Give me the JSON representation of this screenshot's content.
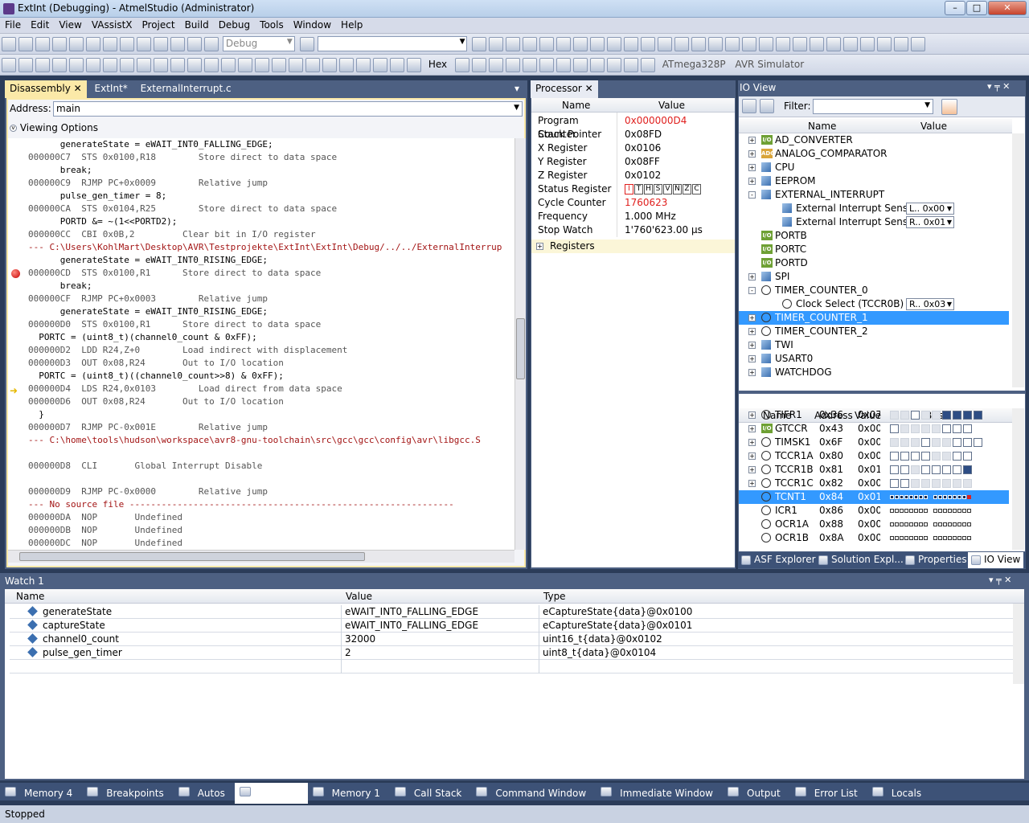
{
  "window": {
    "title": "ExtInt (Debugging) - AtmelStudio (Administrator)",
    "min": "–",
    "max": "□",
    "close": "✕"
  },
  "menu": [
    "File",
    "Edit",
    "View",
    "VAssistX",
    "Project",
    "Build",
    "Debug",
    "Tools",
    "Window",
    "Help"
  ],
  "toolbar": {
    "config": "Debug",
    "hex": "Hex",
    "device": "ATmega328P",
    "tool": "AVR Simulator"
  },
  "disasm": {
    "tabs": [
      "Disassembly",
      "ExtInt*",
      "ExternalInterrupt.c"
    ],
    "address_label": "Address:",
    "address_value": "main",
    "viewing_options": "Viewing Options",
    "lines": [
      {
        "t": "src",
        "text": "      generateState = eWAIT_INT0_FALLING_EDGE;"
      },
      {
        "t": "asm",
        "text": "000000C7  STS 0x0100,R18        Store direct to data space"
      },
      {
        "t": "src",
        "text": "      break;"
      },
      {
        "t": "asm",
        "text": "000000C9  RJMP PC+0x0009        Relative jump"
      },
      {
        "t": "src",
        "text": "      pulse_gen_timer = 8;"
      },
      {
        "t": "asm",
        "text": "000000CA  STS 0x0104,R25        Store direct to data space"
      },
      {
        "t": "src",
        "text": "      PORTD &= ~(1<<PORTD2);"
      },
      {
        "t": "asm",
        "text": "000000CC  CBI 0x0B,2         Clear bit in I/O register"
      },
      {
        "t": "file",
        "text": "--- C:\\Users\\KohlMart\\Desktop\\AVR\\Testprojekte\\ExtInt\\ExtInt\\Debug/../../ExternalInterrup"
      },
      {
        "t": "src",
        "text": "      generateState = eWAIT_INT0_RISING_EDGE;"
      },
      {
        "t": "asm",
        "text": "000000CD  STS 0x0100,R1      Store direct to data space"
      },
      {
        "t": "src",
        "text": "      break;"
      },
      {
        "t": "asm",
        "text": "000000CF  RJMP PC+0x0003        Relative jump"
      },
      {
        "t": "src",
        "text": "      generateState = eWAIT_INT0_RISING_EDGE;"
      },
      {
        "t": "asm",
        "text": "000000D0  STS 0x0100,R1      Store direct to data space"
      },
      {
        "t": "src",
        "text": "  PORTC = (uint8_t)(channel0_count & 0xFF);"
      },
      {
        "t": "asm",
        "text": "000000D2  LDD R24,Z+0        Load indirect with displacement"
      },
      {
        "t": "asm",
        "text": "000000D3  OUT 0x08,R24       Out to I/O location"
      },
      {
        "t": "src",
        "text": "  PORTC = (uint8_t)((channel0_count>>8) & 0xFF);"
      },
      {
        "t": "asm",
        "text": "000000D4  LDS R24,0x0103        Load direct from data space"
      },
      {
        "t": "asm",
        "text": "000000D6  OUT 0x08,R24       Out to I/O location"
      },
      {
        "t": "src",
        "text": "  }"
      },
      {
        "t": "asm",
        "text": "000000D7  RJMP PC-0x001E        Relative jump"
      },
      {
        "t": "file",
        "text": "--- C:\\home\\tools\\hudson\\workspace\\avr8-gnu-toolchain\\src\\gcc\\gcc\\config\\avr\\libgcc.S"
      },
      {
        "t": "asm",
        "text": ""
      },
      {
        "t": "asm",
        "text": "000000D8  CLI       Global Interrupt Disable"
      },
      {
        "t": "asm",
        "text": ""
      },
      {
        "t": "asm",
        "text": "000000D9  RJMP PC-0x0000        Relative jump"
      },
      {
        "t": "file",
        "text": "--- No source file -------------------------------------------------------------"
      },
      {
        "t": "asm",
        "text": "000000DA  NOP       Undefined"
      },
      {
        "t": "asm",
        "text": "000000DB  NOP       Undefined"
      },
      {
        "t": "asm",
        "text": "000000DC  NOP       Undefined"
      }
    ]
  },
  "processor": {
    "tab": "Processor",
    "col_name": "Name",
    "col_value": "Value",
    "rows": [
      {
        "name": "Program Counter",
        "value": "0x000000D4",
        "red": true
      },
      {
        "name": "Stack Pointer",
        "value": "0x08FD"
      },
      {
        "name": "X Register",
        "value": "0x0106"
      },
      {
        "name": "Y Register",
        "value": "0x08FF"
      },
      {
        "name": "Z Register",
        "value": "0x0102"
      },
      {
        "name": "Status Register",
        "value": ""
      },
      {
        "name": "Cycle Counter",
        "value": "1760623",
        "red": true
      },
      {
        "name": "Frequency",
        "value": "1.000 MHz"
      },
      {
        "name": "Stop Watch",
        "value": "1'760'623.00 µs"
      }
    ],
    "sreg_flags": [
      "I",
      "T",
      "H",
      "S",
      "V",
      "N",
      "Z",
      "C"
    ],
    "registers": "Registers"
  },
  "ioview": {
    "title": "IO View",
    "filter_label": "Filter:",
    "col_name": "Name",
    "col_value": "Value",
    "tree": [
      {
        "name": "AD_CONVERTER",
        "icon": "io",
        "exp": "+"
      },
      {
        "name": "ANALOG_COMPARATOR",
        "icon": "ac",
        "exp": "+"
      },
      {
        "name": "CPU",
        "icon": "cube",
        "exp": "+"
      },
      {
        "name": "EEPROM",
        "icon": "cube",
        "exp": "+"
      },
      {
        "name": "EXTERNAL_INTERRUPT",
        "icon": "cube",
        "exp": "-"
      },
      {
        "name": "External Interrupt Sense...",
        "icon": "cube",
        "exp": "",
        "indent": 1,
        "combo": "L.. 0x00"
      },
      {
        "name": "External Interrupt Sense...",
        "icon": "cube",
        "exp": "",
        "indent": 1,
        "combo": "R.. 0x01"
      },
      {
        "name": "PORTB",
        "icon": "io",
        "exp": ""
      },
      {
        "name": "PORTC",
        "icon": "io",
        "exp": ""
      },
      {
        "name": "PORTD",
        "icon": "io",
        "exp": ""
      },
      {
        "name": "SPI",
        "icon": "cube",
        "exp": "+"
      },
      {
        "name": "TIMER_COUNTER_0",
        "icon": "clock",
        "exp": "-"
      },
      {
        "name": "Clock Select (TCCR0B)",
        "icon": "clock",
        "exp": "",
        "indent": 1,
        "combo": "R.. 0x03"
      },
      {
        "name": "TIMER_COUNTER_1",
        "icon": "clock",
        "exp": "+",
        "sel": true
      },
      {
        "name": "TIMER_COUNTER_2",
        "icon": "clock",
        "exp": "+"
      },
      {
        "name": "TWI",
        "icon": "cube",
        "exp": "+"
      },
      {
        "name": "USART0",
        "icon": "cube",
        "exp": "+"
      },
      {
        "name": "WATCHDOG",
        "icon": "cube",
        "exp": "+"
      }
    ],
    "regs_cols": [
      "Name",
      "Address",
      "Value",
      "Bits"
    ],
    "regs": [
      {
        "name": "TIFR1",
        "addr": "0x36",
        "val": "0x07",
        "icon": "clock",
        "bits": "ddhddoooo"
      },
      {
        "name": "GTCCR",
        "addr": "0x43",
        "val": "0x00",
        "icon": "io",
        "bits": "hddddhhh"
      },
      {
        "name": "TIMSK1",
        "addr": "0x6F",
        "val": "0x00",
        "icon": "clock",
        "bits": "dddhddhhh"
      },
      {
        "name": "TCCR1A",
        "addr": "0x80",
        "val": "0x00",
        "icon": "clock",
        "bits": "hhhhddhh"
      },
      {
        "name": "TCCR1B",
        "addr": "0x81",
        "val": "0x01",
        "icon": "clock",
        "bits": "hhdhhhho"
      },
      {
        "name": "TCCR1C",
        "addr": "0x82",
        "val": "0x00",
        "icon": "clock",
        "bits": "hhdddddd"
      },
      {
        "name": "TCNT1",
        "addr": "0x84",
        "val": "0x01",
        "icon": "clock",
        "bits": "small",
        "sel": true
      },
      {
        "name": "ICR1",
        "addr": "0x86",
        "val": "0x00",
        "icon": "clock",
        "bits": "small"
      },
      {
        "name": "OCR1A",
        "addr": "0x88",
        "val": "0x00",
        "icon": "clock",
        "bits": "small"
      },
      {
        "name": "OCR1B",
        "addr": "0x8A",
        "val": "0x00",
        "icon": "clock",
        "bits": "small"
      }
    ],
    "tabs": [
      "ASF Explorer",
      "Solution Expl...",
      "Properties",
      "IO View"
    ]
  },
  "watch": {
    "title": "Watch 1",
    "cols": [
      "Name",
      "Value",
      "Type"
    ],
    "rows": [
      {
        "name": "generateState",
        "value": "eWAIT_INT0_FALLING_EDGE",
        "type": "eCaptureState{data}@0x0100"
      },
      {
        "name": "captureState",
        "value": "eWAIT_INT0_FALLING_EDGE",
        "type": "eCaptureState{data}@0x0101"
      },
      {
        "name": "channel0_count",
        "value": "32000",
        "type": "uint16_t{data}@0x0102"
      },
      {
        "name": "pulse_gen_timer",
        "value": "2",
        "type": "uint8_t{data}@0x0104"
      }
    ]
  },
  "bottomtabs": [
    "Memory 4",
    "Breakpoints",
    "Autos",
    "Watch 1",
    "Memory 1",
    "Call Stack",
    "Command Window",
    "Immediate Window",
    "Output",
    "Error List",
    "Locals"
  ],
  "status": "Stopped",
  "colors": {
    "accent": "#3399ff",
    "red": "#e0201e"
  }
}
